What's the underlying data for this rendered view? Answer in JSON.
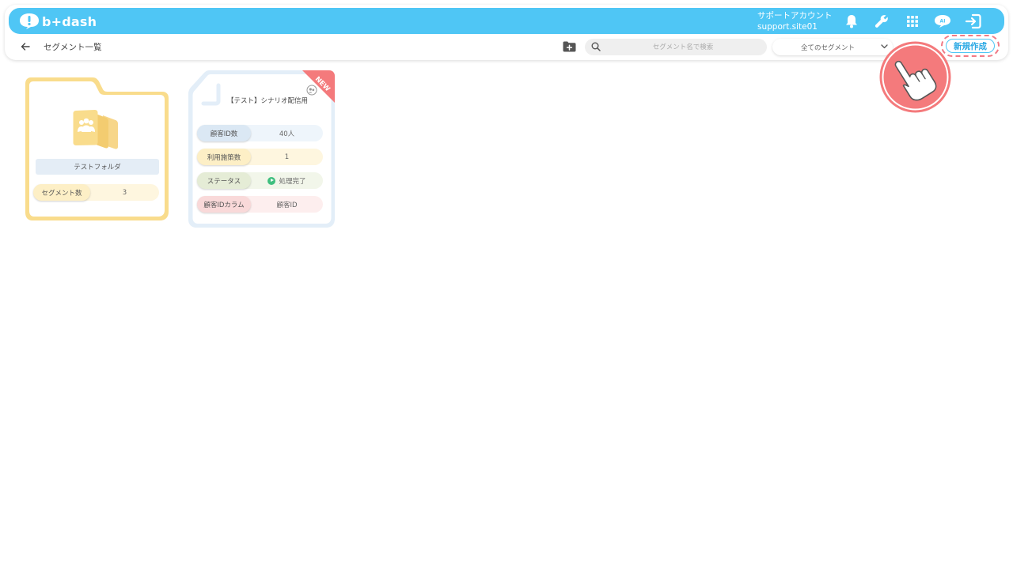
{
  "header": {
    "logo_text": "b+dash",
    "account_name": "サポートアカウント",
    "account_id": "support.site01",
    "icons": [
      "bell-icon",
      "wrench-icon",
      "apps-grid-icon",
      "chat-icon",
      "logout-icon"
    ]
  },
  "toolbar": {
    "page_title": "セグメント一覧",
    "search_placeholder": "セグメント名で検索",
    "filter_value": "全てのセグメント",
    "new_button_label": "新規作成"
  },
  "folder": {
    "name": "テストフォルダ",
    "stat_label": "セグメント数",
    "stat_value": "3"
  },
  "segment": {
    "title": "【テスト】シナリオ配信用",
    "badge": "NEW",
    "rows": [
      {
        "label": "顧客ID数",
        "value": "40人"
      },
      {
        "label": "利用施策数",
        "value": "1"
      },
      {
        "label": "ステータス",
        "value": "処理完了"
      },
      {
        "label": "顧客IDカラム",
        "value": "顧客ID"
      }
    ]
  },
  "colors": {
    "brand": "#4fc6f5",
    "highlight": "#f07a86",
    "folder": "#f9dc8c",
    "status_ok": "#3fbf7f"
  }
}
